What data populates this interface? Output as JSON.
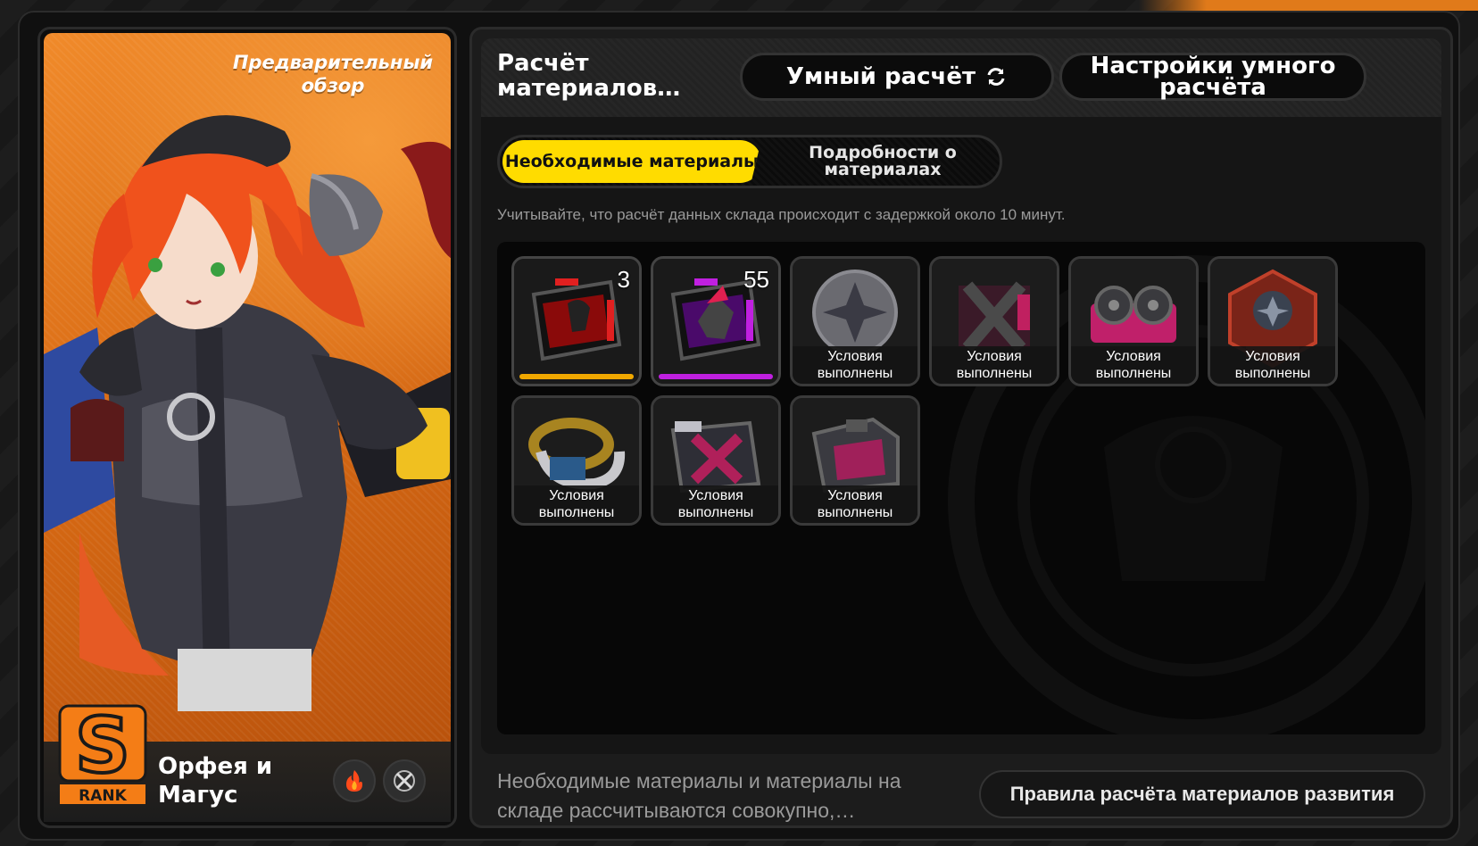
{
  "character": {
    "preview_label": "Предварительный обзор",
    "name": "Орфея и Магус",
    "rank": "S",
    "rank_sub": "RANK",
    "element_icon": "fire-icon",
    "specialty_icon": "crossed-swords-icon"
  },
  "panel": {
    "title": "Расчёт материалов…",
    "smart_calc_label": "Умный расчёт",
    "smart_settings_label": "Настройки умного расчёта"
  },
  "tabs": [
    {
      "label": "Необходимые материалы",
      "active": true
    },
    {
      "label": "Подробности о материалах",
      "active": false
    }
  ],
  "notice": "Учитывайте, что расчёт данных склада происходит с задержкой около 10 минут.",
  "materials": [
    {
      "name": "red-drive-disc-icon",
      "quantity": "3",
      "status": "",
      "accent": "#f0a800"
    },
    {
      "name": "purple-drive-disc-icon",
      "quantity": "55",
      "status": "",
      "accent": "#c020e0"
    },
    {
      "name": "silver-star-badge-icon",
      "quantity": "",
      "status": "Условия выполнены"
    },
    {
      "name": "crossed-blades-chip-icon",
      "quantity": "",
      "status": "Условия выполнены"
    },
    {
      "name": "reel-tape-chip-icon",
      "quantity": "",
      "status": "Условия выполнены"
    },
    {
      "name": "red-hex-badge-icon",
      "quantity": "",
      "status": "Условия выполнены"
    },
    {
      "name": "gold-ring-coil-icon",
      "quantity": "",
      "status": "Условия выполнены"
    },
    {
      "name": "pink-x-chip-icon",
      "quantity": "",
      "status": "Условия выполнены"
    },
    {
      "name": "pink-floppy-chip-icon",
      "quantity": "",
      "status": "Условия выполнены"
    }
  ],
  "footer": {
    "info": "Необходимые материалы и материалы на складе рассчитываются совокупно,…",
    "rules_button": "Правила расчёта материалов развития"
  },
  "colors": {
    "accent": "#ffdc00",
    "card_bg": "#e07a1a",
    "rank": "#f47d16"
  }
}
